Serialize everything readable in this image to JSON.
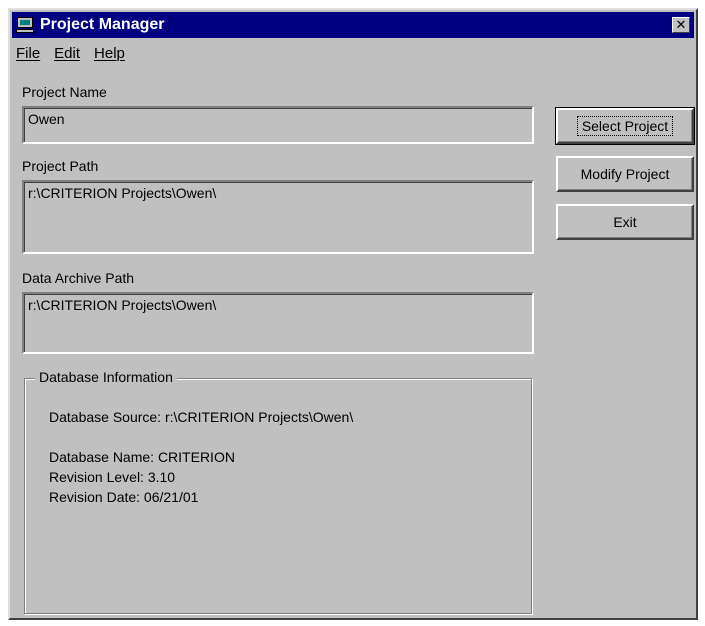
{
  "window": {
    "title": "Project Manager",
    "close_glyph": "✕"
  },
  "menu": {
    "file": "File",
    "edit": "Edit",
    "help": "Help"
  },
  "fields": {
    "project_name_label": "Project Name",
    "project_name_value": "Owen",
    "project_path_label": "Project Path",
    "project_path_value": "r:\\CRITERION Projects\\Owen\\",
    "archive_path_label": "Data Archive Path",
    "archive_path_value": "r:\\CRITERION Projects\\Owen\\"
  },
  "buttons": {
    "select": "Select Project",
    "modify": "Modify Project",
    "exit": "Exit"
  },
  "database": {
    "group_title": "Database Information",
    "source": "Database Source:  r:\\CRITERION Projects\\Owen\\",
    "name": "Database Name:  CRITERION",
    "revision_level": "Revision Level:  3.10",
    "revision_date": "Revision Date:  06/21/01"
  },
  "colors": {
    "titlebar": "#000080",
    "face": "#c0c0c0"
  },
  "icons": {
    "app": "computer-icon",
    "close": "close-icon"
  }
}
